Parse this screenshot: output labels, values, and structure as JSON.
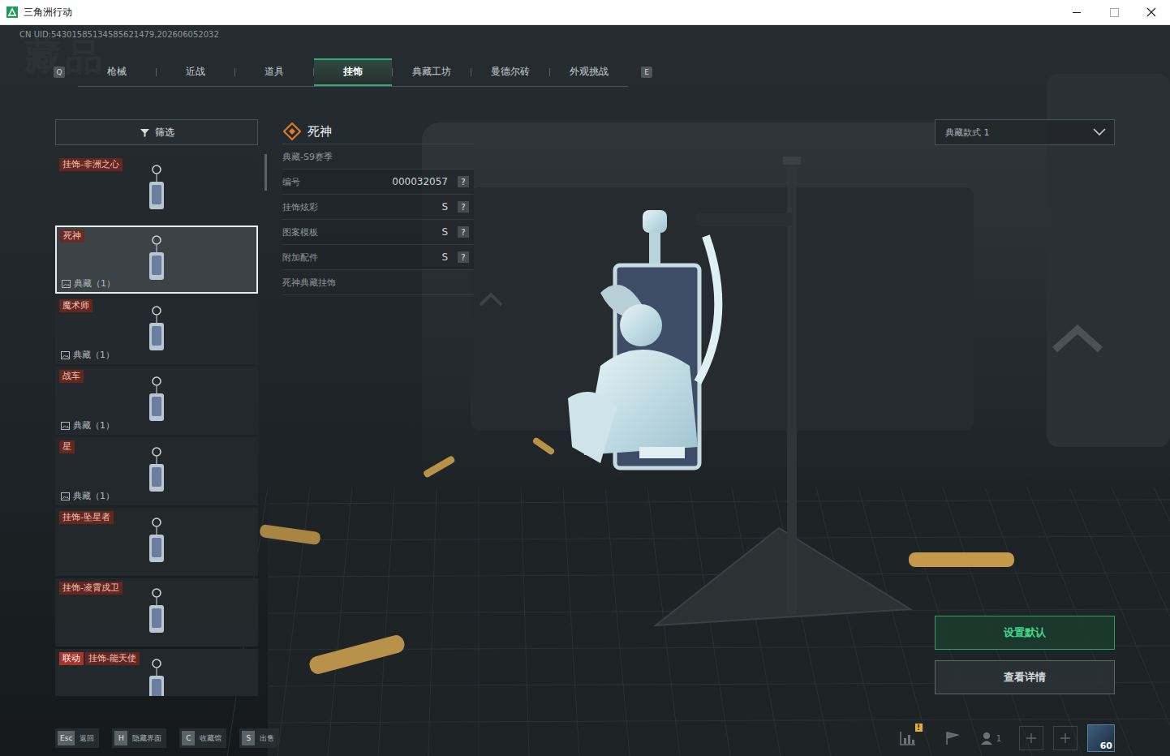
{
  "window": {
    "title": "三角洲行动"
  },
  "uid": "CN UID:54301585134585621479,202606052032",
  "watermark": "藏品",
  "tabs": {
    "prev_key": "Q",
    "next_key": "E",
    "items": [
      {
        "label": "枪械",
        "selected": false
      },
      {
        "label": "近战",
        "selected": false
      },
      {
        "label": "道具",
        "selected": false
      },
      {
        "label": "挂饰",
        "selected": true
      },
      {
        "label": "典藏工坊",
        "selected": false
      },
      {
        "label": "曼德尔砖",
        "selected": false
      },
      {
        "label": "外观挑战",
        "selected": false
      }
    ]
  },
  "filter": {
    "label": "筛选"
  },
  "items": [
    {
      "tag": "挂饰-非洲之心",
      "selected": false
    },
    {
      "tag": "死神",
      "collection": "典藏（1）",
      "selected": true
    },
    {
      "tag": "魔术师",
      "collection": "典藏（1）",
      "selected": false
    },
    {
      "tag": "战车",
      "collection": "典藏（1）",
      "selected": false
    },
    {
      "tag": "星",
      "collection": "典藏（1）",
      "selected": false
    },
    {
      "tag": "挂饰-坠星者",
      "selected": false
    },
    {
      "tag": "挂饰-凌霄戍卫",
      "selected": false
    },
    {
      "badge": "联动",
      "tag": "挂饰-能天使",
      "selected": false
    }
  ],
  "detail": {
    "name": "死神",
    "season": "典藏-S9赛季",
    "attributes": [
      {
        "label": "编号",
        "value": "000032057",
        "help": "?"
      },
      {
        "label": "挂饰炫彩",
        "value": "S",
        "help": "?"
      },
      {
        "label": "图案模板",
        "value": "S",
        "help": "?"
      },
      {
        "label": "附加配件",
        "value": "S",
        "help": "?"
      }
    ],
    "description": "死神典藏挂饰"
  },
  "style_dropdown": {
    "value": "典藏款式 1"
  },
  "buttons": [
    {
      "label": "设置默认",
      "primary": true
    },
    {
      "label": "查看详情",
      "primary": false
    }
  ],
  "hints": [
    {
      "key": "Esc",
      "label": "返回"
    },
    {
      "key": "H",
      "label": "隐藏界面"
    },
    {
      "key": "C",
      "label": "收藏馆"
    },
    {
      "key": "S",
      "label": "出售"
    }
  ],
  "status": {
    "alert": "!",
    "friends": "1",
    "level": "60"
  }
}
